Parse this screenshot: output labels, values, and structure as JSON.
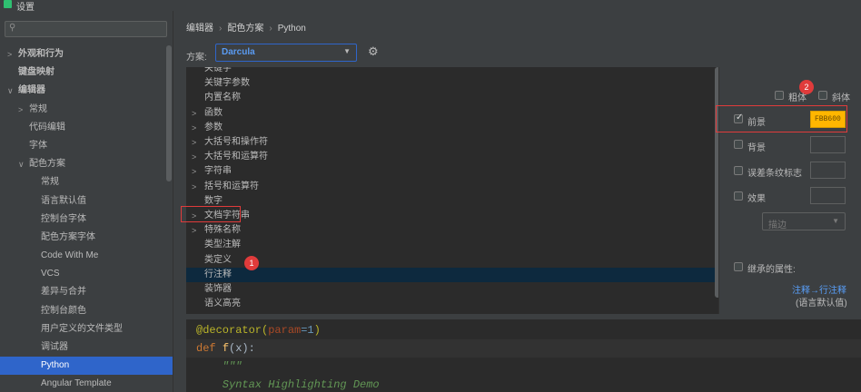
{
  "window": {
    "title": "设置"
  },
  "sidebar": {
    "search_placeholder": "",
    "items": [
      {
        "label": "外观和行为",
        "chevron": ">",
        "bold": true
      },
      {
        "label": "键盘映射",
        "chevron": "",
        "bold": true
      },
      {
        "label": "编辑器",
        "chevron": "∨",
        "bold": true
      },
      {
        "label": "常规",
        "chevron": ">"
      },
      {
        "label": "代码编辑",
        "chevron": ""
      },
      {
        "label": "字体",
        "chevron": ""
      },
      {
        "label": "配色方案",
        "chevron": "∨"
      },
      {
        "label": "常规",
        "chevron": ""
      },
      {
        "label": "语言默认值",
        "chevron": ""
      },
      {
        "label": "控制台字体",
        "chevron": ""
      },
      {
        "label": "配色方案字体",
        "chevron": ""
      },
      {
        "label": "Code With Me",
        "chevron": ""
      },
      {
        "label": "VCS",
        "chevron": ""
      },
      {
        "label": "差异与合并",
        "chevron": ""
      },
      {
        "label": "控制台颜色",
        "chevron": ""
      },
      {
        "label": "用户定义的文件类型",
        "chevron": ""
      },
      {
        "label": "调试器",
        "chevron": ""
      },
      {
        "label": "Python",
        "chevron": "",
        "selected": true
      },
      {
        "label": "Angular Template",
        "chevron": ""
      }
    ]
  },
  "breadcrumb": {
    "part1": "编辑器",
    "part2": "配色方案",
    "part3": "Python",
    "sep": "›"
  },
  "scheme": {
    "label": "方案:",
    "value": "Darcula"
  },
  "tree": {
    "items": [
      {
        "label": "关键字",
        "chevron": ""
      },
      {
        "label": "关键字参数",
        "chevron": ""
      },
      {
        "label": "内置名称",
        "chevron": ""
      },
      {
        "label": "函数",
        "chevron": ">"
      },
      {
        "label": "参数",
        "chevron": ">"
      },
      {
        "label": "大括号和操作符",
        "chevron": ">"
      },
      {
        "label": "大括号和运算符",
        "chevron": ">"
      },
      {
        "label": "字符串",
        "chevron": ">"
      },
      {
        "label": "括号和运算符",
        "chevron": ">"
      },
      {
        "label": "数字",
        "chevron": ""
      },
      {
        "label": "文档字符串",
        "chevron": ">"
      },
      {
        "label": "特殊名称",
        "chevron": ">"
      },
      {
        "label": "类型注解",
        "chevron": ""
      },
      {
        "label": "类定义",
        "chevron": ""
      },
      {
        "label": "行注释",
        "chevron": "",
        "selected": true
      },
      {
        "label": "装饰器",
        "chevron": ""
      },
      {
        "label": "语义高亮",
        "chevron": ""
      }
    ]
  },
  "badges": {
    "one": "1",
    "two": "2"
  },
  "options": {
    "bold": "粗体",
    "italic": "斜体",
    "foreground": "前景",
    "foreground_color": "FBB600",
    "background": "背景",
    "error_stripe": "误差条纹标志",
    "effects": "效果",
    "effect_type": "描边",
    "inherited": "继承的属性:",
    "inherit_link": "注释→行注释",
    "inherit_note": "(语言默认值)"
  },
  "colors": {
    "accent": "#2f65ca",
    "foreground_swatch": "#ffb600",
    "badge": "#e03b3b"
  },
  "preview": {
    "lines": [
      {
        "text": "@decorator(",
        "parts": [
          {
            "t": "@decorator(",
            "c": "#bbb529"
          },
          {
            "t": "param",
            "c": "#aa4926"
          },
          {
            "t": "=1",
            "c": "#6897bb"
          },
          {
            "t": ")",
            "c": "#bbb529"
          }
        ]
      },
      {
        "parts": [
          {
            "t": "def ",
            "c": "#cc7832"
          },
          {
            "t": "f",
            "c": "#ffc66d"
          },
          {
            "t": "(x):",
            "c": "#a9b7c6"
          }
        ]
      },
      {
        "parts": [
          {
            "t": "    \"\"\"",
            "c": "#629755"
          }
        ]
      },
      {
        "parts": [
          {
            "t": "    Syntax Highlighting Demo",
            "c": "#629755"
          }
        ]
      }
    ]
  }
}
